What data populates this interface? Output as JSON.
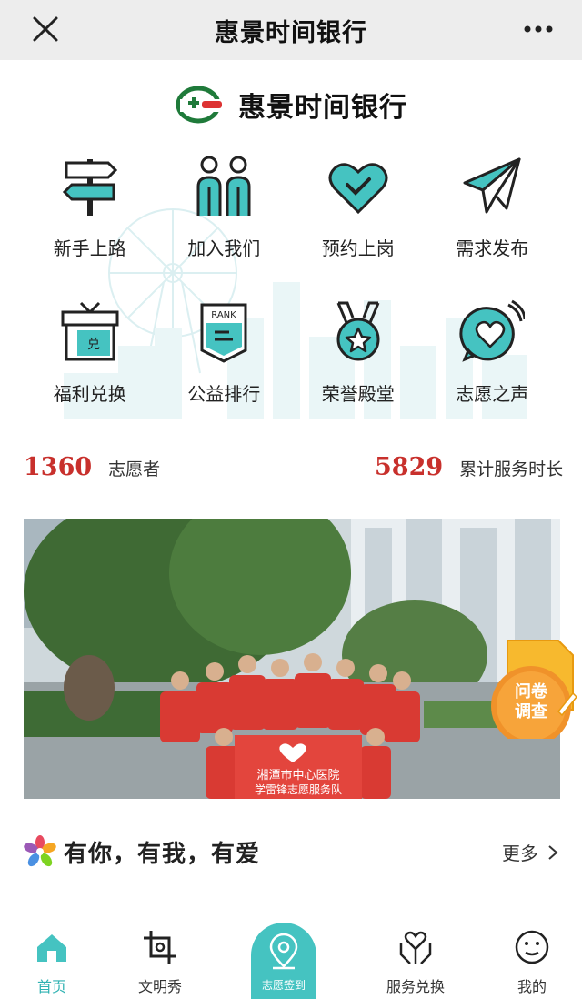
{
  "header": {
    "title": "惠景时间银行"
  },
  "brand": {
    "name": "惠景时间银行"
  },
  "menu": [
    {
      "label": "新手上路",
      "icon": "signpost-icon"
    },
    {
      "label": "加入我们",
      "icon": "people-icon"
    },
    {
      "label": "预约上岗",
      "icon": "heart-check-icon"
    },
    {
      "label": "需求发布",
      "icon": "paper-plane-icon"
    },
    {
      "label": "福利兑换",
      "icon": "gift-box-icon",
      "badge": "兑"
    },
    {
      "label": "公益排行",
      "icon": "rank-banner-icon",
      "badge": "RANK"
    },
    {
      "label": "荣誉殿堂",
      "icon": "medal-icon"
    },
    {
      "label": "志愿之声",
      "icon": "voice-heart-icon"
    }
  ],
  "stats": {
    "volunteers": {
      "value": "1360",
      "label": "志愿者"
    },
    "hours": {
      "value": "5829",
      "label": "累计服务时长"
    }
  },
  "banner": {
    "sign_line1": "湘潭市中心医院",
    "sign_line2": "学雷锋志愿服务队"
  },
  "survey": {
    "line1": "问卷",
    "line2": "调查"
  },
  "section": {
    "title": "有你，有我，有爱",
    "more": "更多"
  },
  "tabs": [
    {
      "label": "首页"
    },
    {
      "label": "文明秀"
    },
    {
      "label": "志愿签到"
    },
    {
      "label": "服务兑换"
    },
    {
      "label": "我的"
    }
  ],
  "colors": {
    "accent": "#45c3c1",
    "stat_red": "#c8302c",
    "topbar": "#ededed"
  }
}
